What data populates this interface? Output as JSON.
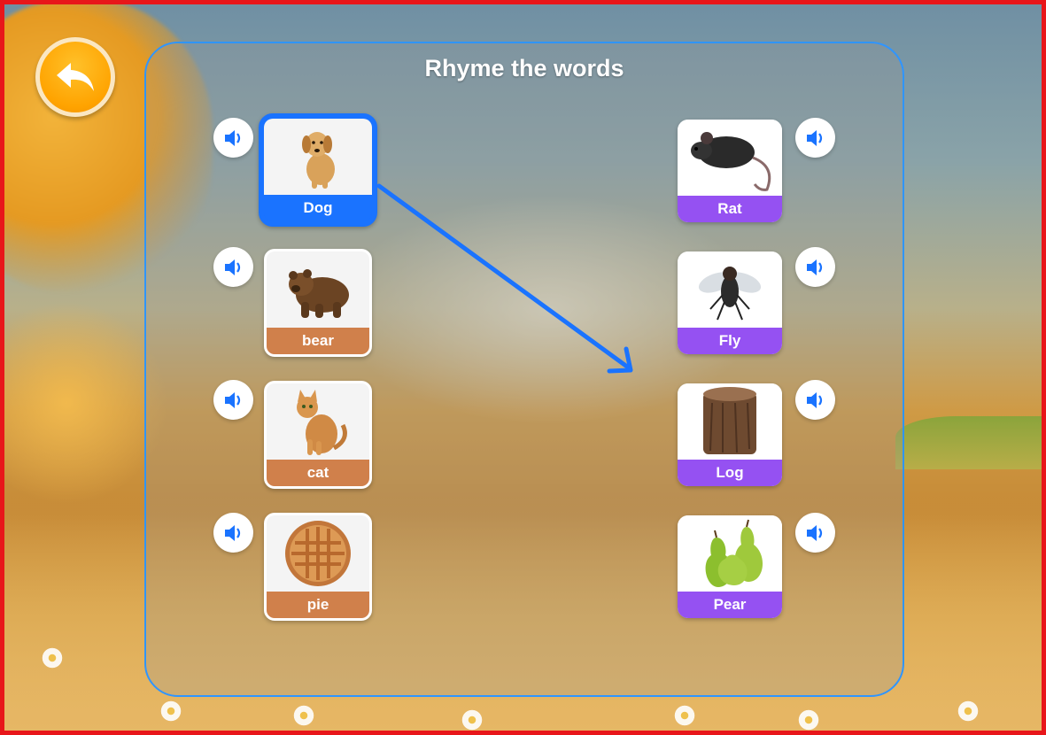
{
  "title": "Rhyme the words",
  "left_items": [
    {
      "label": "Dog",
      "image": "dog",
      "selected": true
    },
    {
      "label": "bear",
      "image": "bear",
      "selected": false
    },
    {
      "label": "cat",
      "image": "cat",
      "selected": false
    },
    {
      "label": "pie",
      "image": "pie",
      "selected": false
    }
  ],
  "right_items": [
    {
      "label": "Rat",
      "image": "rat"
    },
    {
      "label": "Fly",
      "image": "fly"
    },
    {
      "label": "Log",
      "image": "log"
    },
    {
      "label": "Pear",
      "image": "pear"
    }
  ],
  "icons": {
    "back": "undo-arrow-icon",
    "speaker": "speaker-icon"
  },
  "colors": {
    "panel_border": "#2f95ff",
    "selected": "#1a73ff",
    "left_label": "#d0804b",
    "right_label": "#9551f2",
    "back_button": "#ffa300"
  }
}
